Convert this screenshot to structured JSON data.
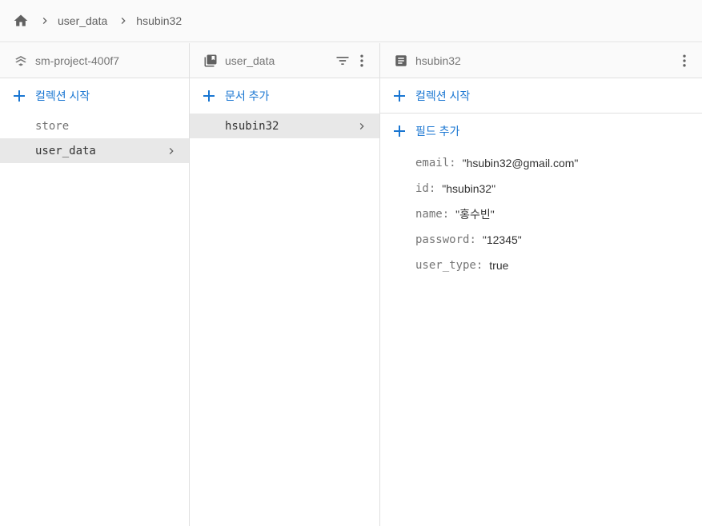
{
  "breadcrumb": {
    "items": [
      "user_data",
      "hsubin32"
    ]
  },
  "columns": {
    "project": {
      "title": "sm-project-400f7",
      "add_label": "컬렉션 시작",
      "items": [
        {
          "label": "store"
        },
        {
          "label": "user_data"
        }
      ]
    },
    "collection": {
      "title": "user_data",
      "add_label": "문서 추가",
      "items": [
        {
          "label": "hsubin32"
        }
      ]
    },
    "document": {
      "title": "hsubin32",
      "add_collection_label": "컬렉션 시작",
      "add_field_label": "필드 추가",
      "fields": [
        {
          "key": "email",
          "value": "\"hsubin32@gmail.com\""
        },
        {
          "key": "id",
          "value": "\"hsubin32\""
        },
        {
          "key": "name",
          "value": "\"홍수빈\""
        },
        {
          "key": "password",
          "value": "\"12345\""
        },
        {
          "key": "user_type",
          "value": "true"
        }
      ]
    }
  },
  "colors": {
    "accent": "#1976d2",
    "selected_bg": "#e8e8e8",
    "border": "#e0e0e0",
    "header_bg": "#fafafa"
  }
}
